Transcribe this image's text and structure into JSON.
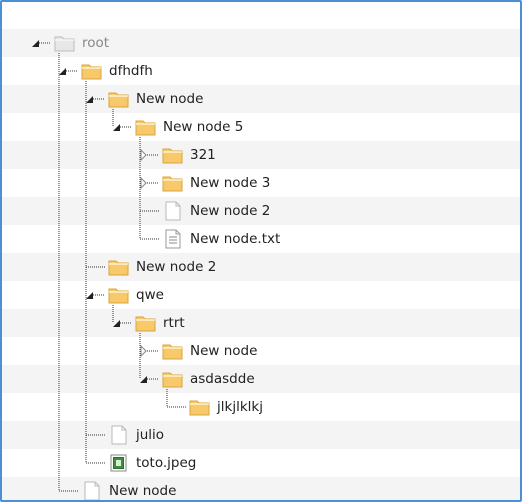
{
  "tree": [
    {
      "label": "root",
      "depth": 0,
      "kind": "root",
      "toggle": "expanded"
    },
    {
      "label": "dfhdfh",
      "depth": 1,
      "kind": "folder",
      "toggle": "expanded"
    },
    {
      "label": "New node",
      "depth": 2,
      "kind": "folder",
      "toggle": "expanded"
    },
    {
      "label": "New node 5",
      "depth": 3,
      "kind": "folder",
      "toggle": "expanded"
    },
    {
      "label": "321",
      "depth": 4,
      "kind": "folder",
      "toggle": "collapsed"
    },
    {
      "label": "New node 3",
      "depth": 4,
      "kind": "folder",
      "toggle": "collapsed"
    },
    {
      "label": "New node 2",
      "depth": 4,
      "kind": "file",
      "toggle": "none"
    },
    {
      "label": "New node.txt",
      "depth": 4,
      "kind": "text-file",
      "toggle": "none"
    },
    {
      "label": "New node 2",
      "depth": 2,
      "kind": "folder",
      "toggle": "none"
    },
    {
      "label": "qwe",
      "depth": 2,
      "kind": "folder",
      "toggle": "expanded"
    },
    {
      "label": "rtrt",
      "depth": 3,
      "kind": "folder",
      "toggle": "expanded"
    },
    {
      "label": "New node",
      "depth": 4,
      "kind": "folder",
      "toggle": "collapsed"
    },
    {
      "label": "asdasdde",
      "depth": 4,
      "kind": "folder",
      "toggle": "expanded"
    },
    {
      "label": "jlkjlklkj",
      "depth": 5,
      "kind": "folder",
      "toggle": "none"
    },
    {
      "label": "julio",
      "depth": 2,
      "kind": "file",
      "toggle": "none"
    },
    {
      "label": "toto.jpeg",
      "depth": 2,
      "kind": "image-file",
      "toggle": "none"
    },
    {
      "label": "New node",
      "depth": 1,
      "kind": "file",
      "toggle": "none"
    }
  ],
  "colors": {
    "frame": "#4a90d9",
    "stripe": "#f4f4f4",
    "folder": "#f7c96a",
    "folder_border": "#d9a43a",
    "connector": "#333333"
  }
}
